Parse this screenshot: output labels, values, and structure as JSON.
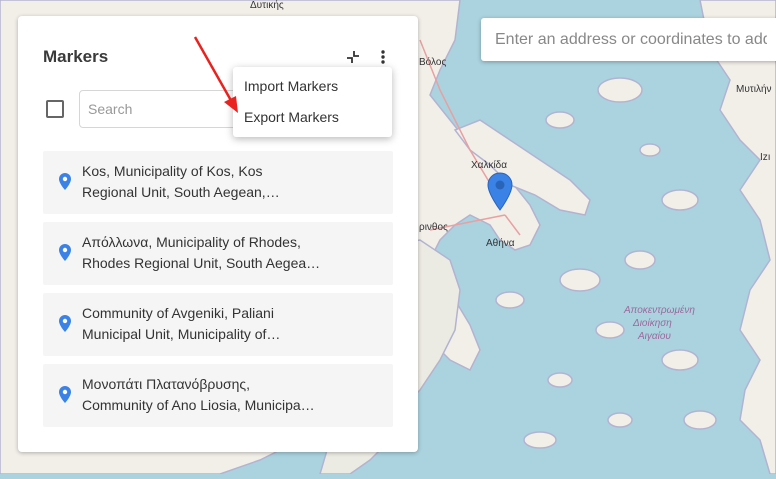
{
  "map": {
    "labels": {
      "top_greek": "Δυτικής",
      "volos": "Βόλος",
      "chalkida": "Χαλκίδα",
      "corinth": "ρινθος",
      "athens": "Αθήνα",
      "mytilene": "Μυτιλήν",
      "izmir": "Izı",
      "aegean_1": "Αποκεντρωμένη",
      "aegean_2": "Διοίκηση",
      "aegean_3": "Αιγαίου"
    },
    "marker_color": "#3b82e6"
  },
  "address_search": {
    "placeholder": "Enter an address or coordinates to add"
  },
  "panel": {
    "title": "Markers",
    "search_placeholder": "Search",
    "markers": [
      {
        "line1": "Kos, Municipality of Kos, Kos",
        "line2": "Regional Unit, South Aegean,…"
      },
      {
        "line1": "Απόλλωνα, Municipality of Rhodes,",
        "line2": "Rhodes Regional Unit, South Aegea…"
      },
      {
        "line1": "Community of Avgeniki, Paliani",
        "line2": "Municipal Unit, Municipality of…"
      },
      {
        "line1": "Μονοπάτι Πλατανόβρυσης,",
        "line2": "Community of Ano Liosia, Municipa…"
      }
    ]
  },
  "menu": {
    "import": "Import Markers",
    "export": "Export Markers"
  },
  "colors": {
    "accent": "#3b82e6",
    "annotation_arrow": "#e8231f",
    "water": "#aad3df",
    "land": "#f2efe9"
  }
}
